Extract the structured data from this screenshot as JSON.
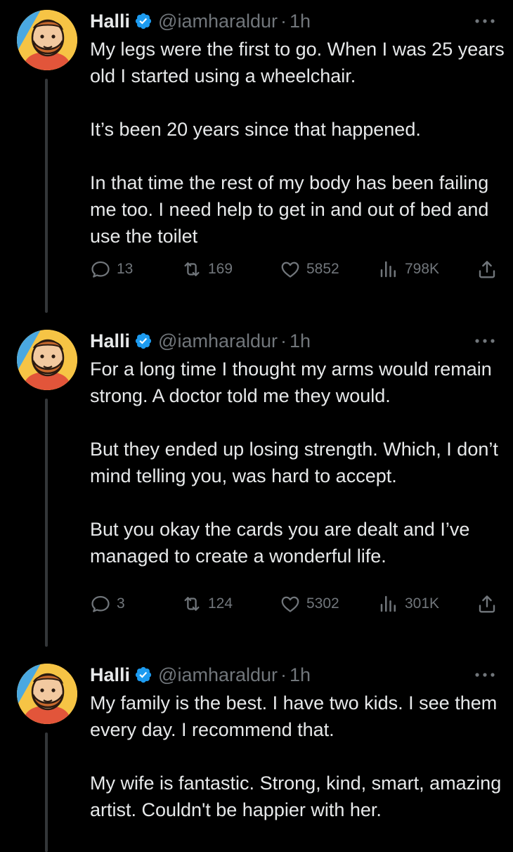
{
  "colors": {
    "background": "#000000",
    "text": "#e7e9ea",
    "secondary": "#71767b",
    "verified": "#1d9bf0",
    "thread_line": "#333639",
    "avatar_bg": "#f6c445"
  },
  "icons": {
    "verified": "verified-badge-icon",
    "more": "more-dots-icon",
    "reply": "reply-icon",
    "retweet": "retweet-icon",
    "like": "heart-icon",
    "views": "views-chart-icon",
    "share": "share-icon"
  },
  "tweets": [
    {
      "name": "Halli",
      "handle": "@iamharaldur",
      "separator": "·",
      "time": "1h",
      "paragraphs": [
        "My legs were the first to go. When I was 25 years old I started using a wheelchair.",
        "It’s been 20 years since that happened.",
        "In that time the rest of my body has been failing me too. I need help to get in and out of bed and use the toilet"
      ],
      "stats": {
        "replies": "13",
        "retweets": "169",
        "likes": "5852",
        "views": "798K"
      }
    },
    {
      "name": "Halli",
      "handle": "@iamharaldur",
      "separator": "·",
      "time": "1h",
      "paragraphs": [
        "For a long time I thought my arms would remain strong. A doctor told me they would.",
        "But they ended up losing strength. Which, I don’t mind telling you, was hard to accept.",
        "But you okay the cards you are dealt and I’ve managed to create a wonderful life."
      ],
      "stats": {
        "replies": "3",
        "retweets": "124",
        "likes": "5302",
        "views": "301K"
      }
    },
    {
      "name": "Halli",
      "handle": "@iamharaldur",
      "separator": "·",
      "time": "1h",
      "paragraphs": [
        "My family is the best. I have two kids. I see them every day. I recommend that.",
        "My wife is fantastic. Strong, kind, smart, amazing artist. Couldn't be happier with her."
      ]
    }
  ]
}
